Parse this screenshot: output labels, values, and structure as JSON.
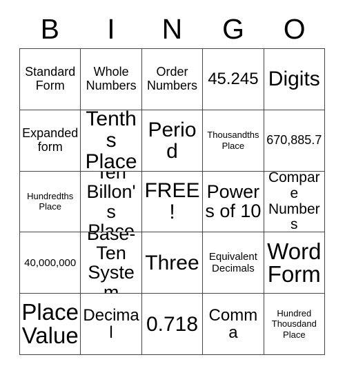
{
  "card": {
    "title_letters": [
      "B",
      "I",
      "N",
      "G",
      "O"
    ],
    "colors": {
      "background": "#ffffff",
      "text": "#000000",
      "grid_line": "#444444"
    },
    "free_space": "FREE!",
    "grid": {
      "rows": 5,
      "columns": 5,
      "cells": [
        [
          {
            "text": "Standard Form",
            "size": "md"
          },
          {
            "text": "Whole Numbers",
            "size": "md"
          },
          {
            "text": "Order Numbers",
            "size": "md"
          },
          {
            "text": "45.245",
            "size": "xl"
          },
          {
            "text": "Digits",
            "size": "3xl"
          }
        ],
        [
          {
            "text": "Expanded form",
            "size": "md"
          },
          {
            "text": "Tenths Place",
            "size": "3xl"
          },
          {
            "text": "Period",
            "size": "3xl"
          },
          {
            "text": "Thousandths Place",
            "size": "xs"
          },
          {
            "text": "670,885.7",
            "size": "md"
          }
        ],
        [
          {
            "text": "Hundredths Place",
            "size": "xs"
          },
          {
            "text": "Ten Billon's Place",
            "size": "2xl"
          },
          {
            "text": "FREE!",
            "size": "3xl"
          },
          {
            "text": "Powers of 10",
            "size": "2xl"
          },
          {
            "text": "Compare Numbers",
            "size": "lg"
          }
        ],
        [
          {
            "text": "40,000,000",
            "size": "sm"
          },
          {
            "text": "Base-Ten System",
            "size": "2xl"
          },
          {
            "text": "Three",
            "size": "3xl"
          },
          {
            "text": "Equivalent Decimals",
            "size": "sm"
          },
          {
            "text": "Word Form",
            "size": "4xl"
          }
        ],
        [
          {
            "text": "Place Value",
            "size": "4xl"
          },
          {
            "text": "Decimal",
            "size": "xl"
          },
          {
            "text": "0.718",
            "size": "3xl"
          },
          {
            "text": "Comma",
            "size": "xl"
          },
          {
            "text": "Hundred Thousdand Place",
            "size": "xs"
          }
        ]
      ]
    }
  }
}
